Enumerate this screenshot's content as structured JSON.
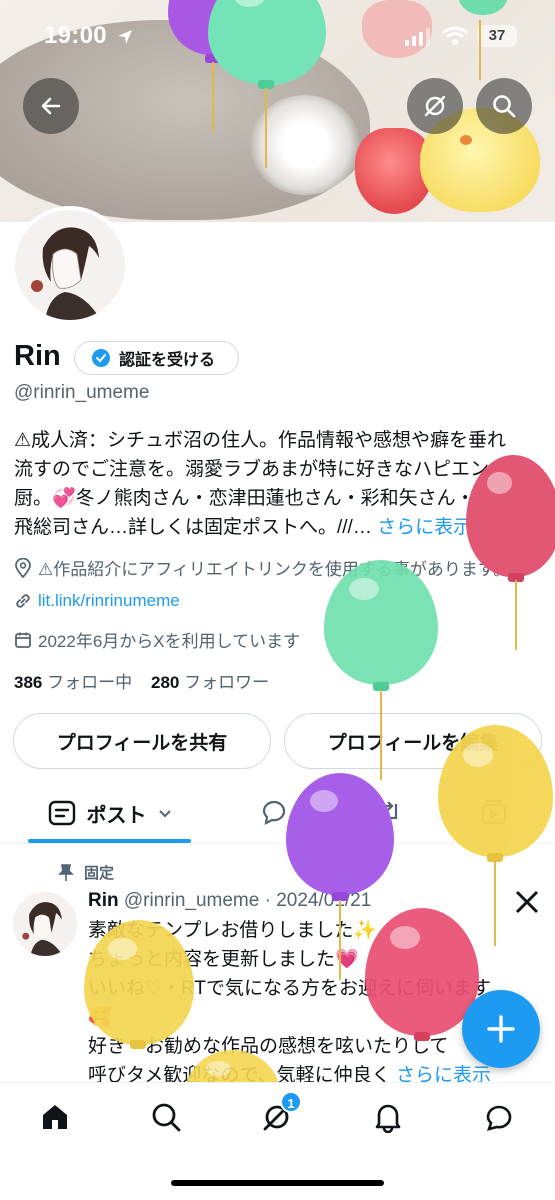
{
  "status_bar": {
    "time": "19:00",
    "battery": "37"
  },
  "profile": {
    "name": "Rin",
    "verify_label": "認証を受ける",
    "handle": "@rinrin_umeme",
    "bio_lines": [
      "⚠成人済：シチュボ沼の住人。作品情報や感想や癖を垂れ",
      "流すのでご注意を。溺愛ラブあまが特に好きなハピエン",
      "厨。💞冬ノ熊肉さん・恋津田蓮也さん・彩和矢さん・猿",
      "飛総司さん…詳しくは固定ポストへ。///…"
    ],
    "bio_more": "さらに表示",
    "location": "⚠作品紹介にアフィリエイトリンクを使用する事があります。",
    "link": "lit.link/rinrinumeme",
    "joined": "2022年6月からXを利用しています",
    "following_count": "386",
    "following_label": "フォロー中",
    "followers_count": "280",
    "followers_label": "フォロワー",
    "share_button": "プロフィールを共有",
    "edit_button": "プロフィールを編集"
  },
  "tabs": {
    "active_label": "ポスト"
  },
  "post": {
    "pinned_label": "固定",
    "author": "Rin",
    "handle_date": "@rinrin_umeme · 2024/01/21",
    "lines": [
      "素敵なテンプレお借りしました✨",
      "ちょっと内容を更新しました💗",
      "いいね♡・RTで気になる方をお迎えに伺います",
      "🥰",
      "好き・お勧めな作品の感想を呟いたりして",
      "呼びタメ歓迎なので、気軽に仲良く"
    ],
    "more": "さらに表示"
  },
  "bottom_nav": {
    "notification_badge": "1"
  },
  "icons": {
    "back": "back-arrow-icon",
    "grok": "grok-icon",
    "search": "search-icon",
    "verified": "verified-badge-icon",
    "location": "location-icon",
    "link": "link-icon",
    "calendar": "calendar-icon",
    "post_tab": "post-tab-icon",
    "pin": "pin-icon",
    "x_logo": "x-logo-icon",
    "compose": "plus-icon",
    "home": "home-icon",
    "notifications": "bell-icon",
    "messages": "message-icon"
  },
  "colors": {
    "accent": "#1d9bf0",
    "text": "#0f1419",
    "muted": "#536471"
  }
}
